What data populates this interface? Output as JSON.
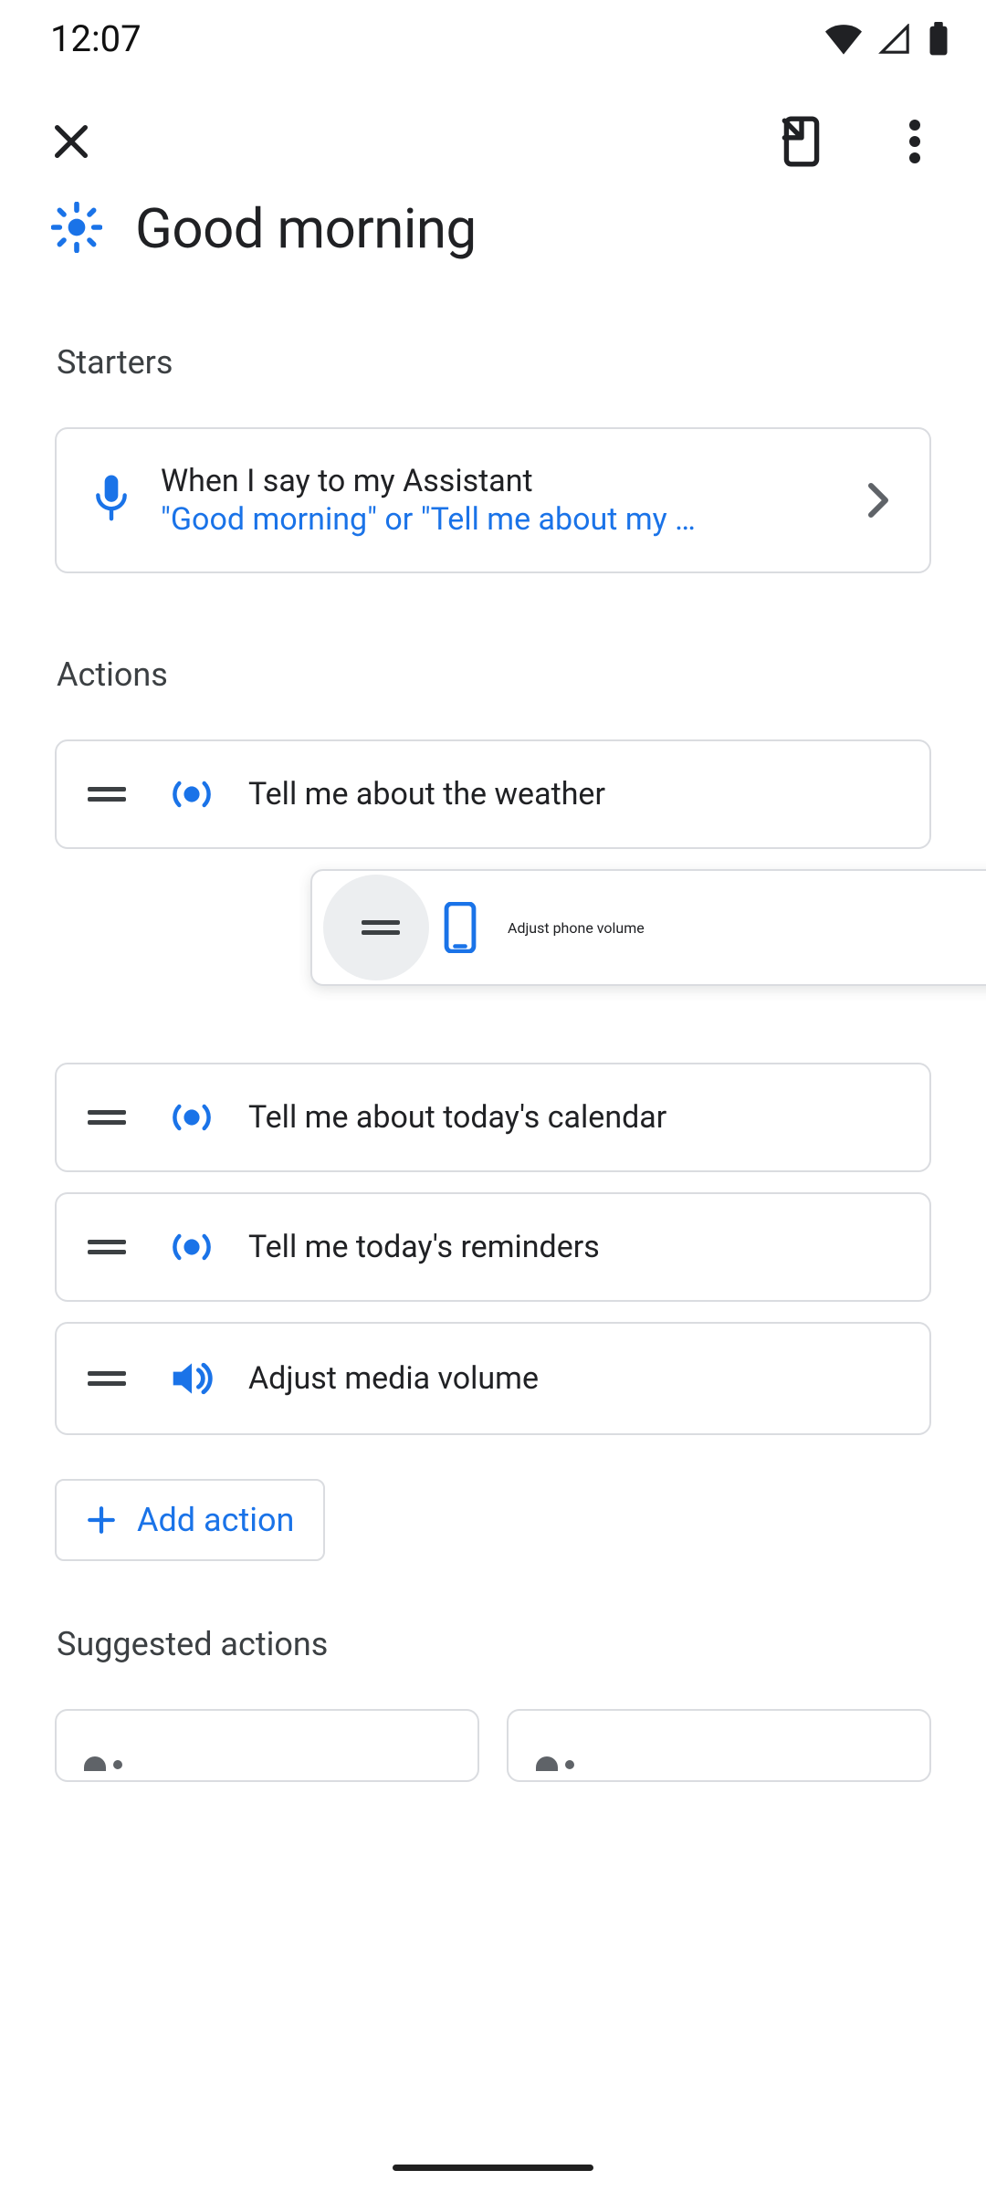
{
  "status": {
    "time": "12:07"
  },
  "title": "Good morning",
  "sections": {
    "starters_label": "Starters",
    "actions_label": "Actions",
    "suggested_label": "Suggested actions"
  },
  "starter": {
    "line1": "When I say to my Assistant",
    "line2": "\"Good morning\" or \"Tell me about my …"
  },
  "actions": [
    {
      "icon": "broadcast",
      "label": "Tell me about the weather"
    },
    {
      "icon": "phone",
      "label": "Adjust phone volume",
      "dragged": true
    },
    {
      "icon": "broadcast",
      "label": "Tell me about today's calendar"
    },
    {
      "icon": "broadcast",
      "label": "Tell me today's reminders"
    },
    {
      "icon": "volume",
      "label": "Adjust media volume"
    }
  ],
  "add_action_label": "Add action",
  "colors": {
    "accent": "#1a73e8",
    "border": "#dadce0"
  }
}
